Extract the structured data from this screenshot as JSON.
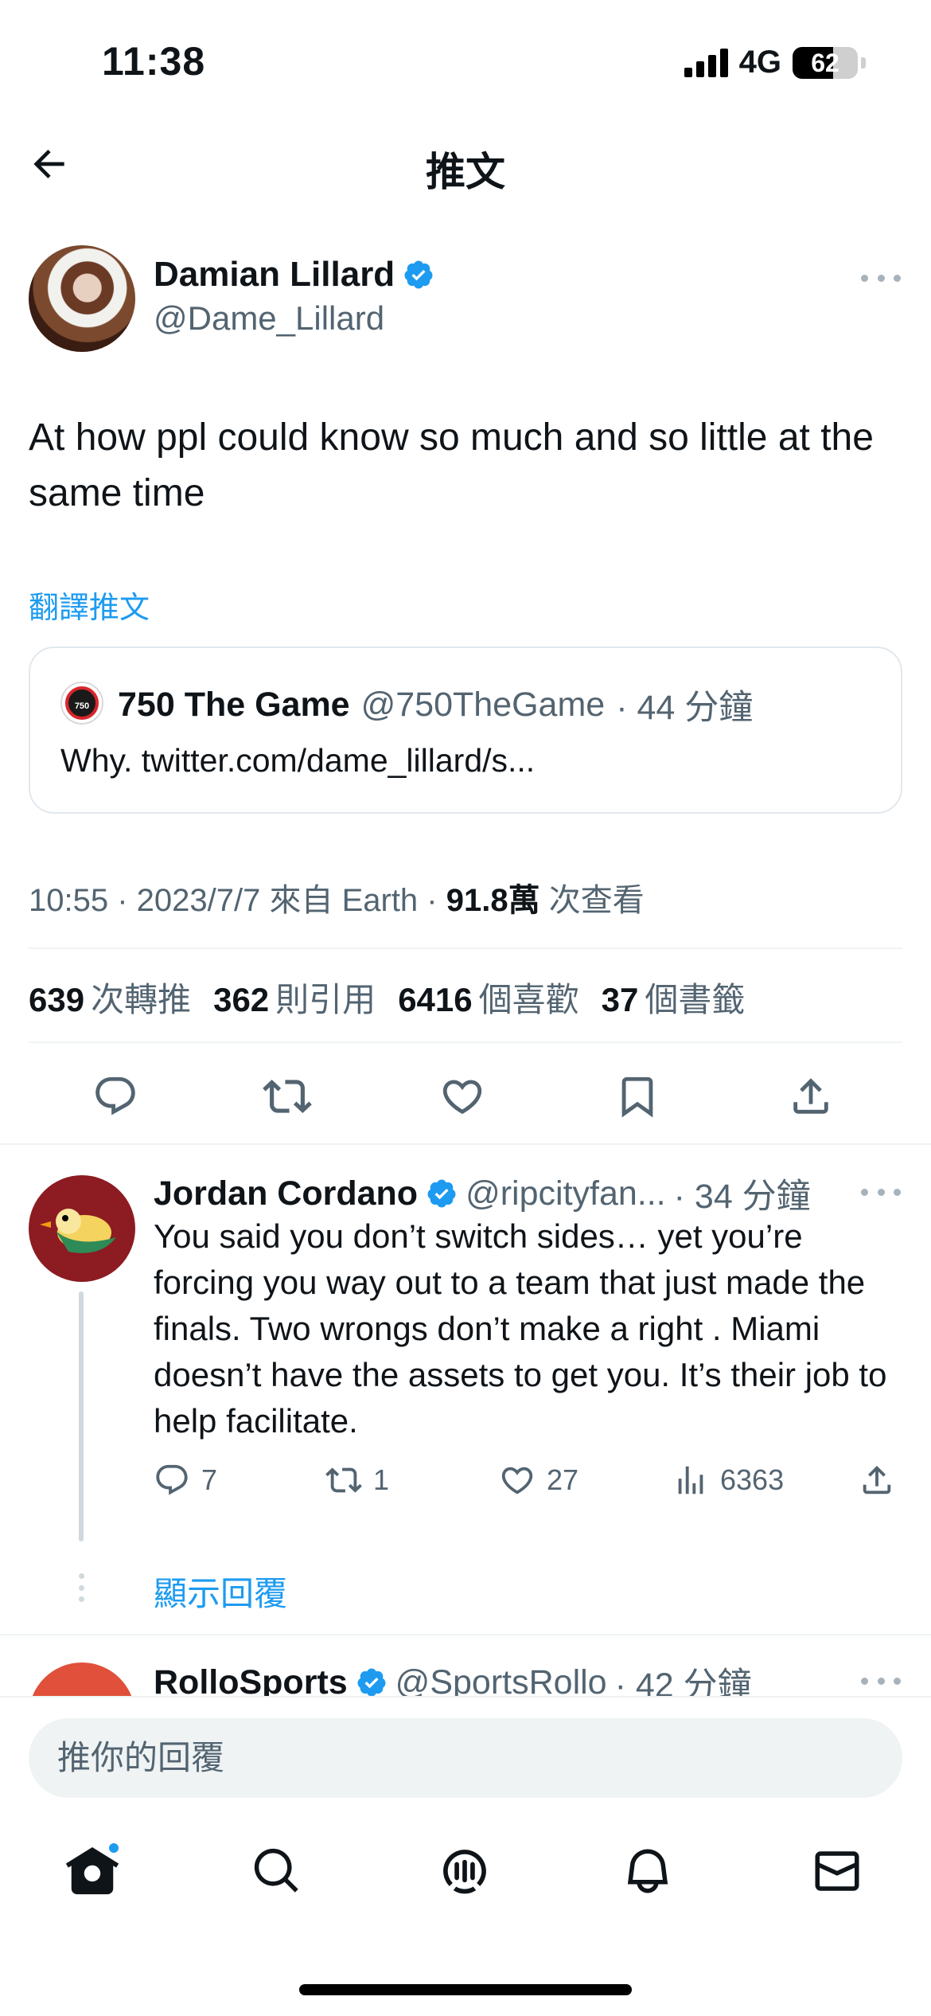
{
  "status_bar": {
    "time": "11:38",
    "network": "4G",
    "battery": "62",
    "battery_level": 0.62
  },
  "header": {
    "title": "推文"
  },
  "tweet": {
    "author_name": "Damian Lillard",
    "author_handle": "@Dame_Lillard",
    "text": "At how ppl could know so much and so little at the same time",
    "translate_label": "翻譯推文",
    "quote": {
      "name": "750 The Game",
      "handle": "@750TheGame",
      "time": "· 44 分鐘",
      "text": "Why. twitter.com/dame_lillard/s...",
      "logo_text": "THE GAME 750"
    },
    "meta": {
      "timestamp": "10:55 · 2023/7/7 來自 Earth · ",
      "views_num": "91.8萬",
      "views_label": " 次查看"
    },
    "stats": {
      "retweets_num": "639",
      "retweets_label": "次轉推",
      "quotes_num": "362",
      "quotes_label": "則引用",
      "likes_num": "6416",
      "likes_label": "個喜歡",
      "bookmarks_num": "37",
      "bookmarks_label": "個書籤"
    }
  },
  "reply": {
    "name": "Jordan Cordano",
    "handle": "@ripcityfan...",
    "time": "· 34 分鐘",
    "text": "You said you don’t switch sides… yet you’re forcing you way out to a team that just made the finals. Two wrongs don’t make a right . Miami doesn’t have the assets to get you. It’s their job to help facilitate.",
    "replies": "7",
    "retweets": "1",
    "likes": "27",
    "views": "6363",
    "show_replies": "顯示回覆"
  },
  "reply2": {
    "name": "RolloSports",
    "handle": "@SportsRollo",
    "time": "· 42 分鐘"
  },
  "composer": {
    "placeholder": "推你的回覆"
  },
  "colors": {
    "accent": "#1d9bf0",
    "text": "#0f1419",
    "secondary": "#536471",
    "divider": "#eff3f4"
  },
  "icons": [
    "back-arrow-icon",
    "verified-icon",
    "more-icon",
    "reply-icon",
    "retweet-icon",
    "like-icon",
    "bookmark-icon",
    "share-icon",
    "views-icon",
    "home-icon",
    "search-icon",
    "spaces-icon",
    "notifications-icon",
    "messages-icon"
  ]
}
